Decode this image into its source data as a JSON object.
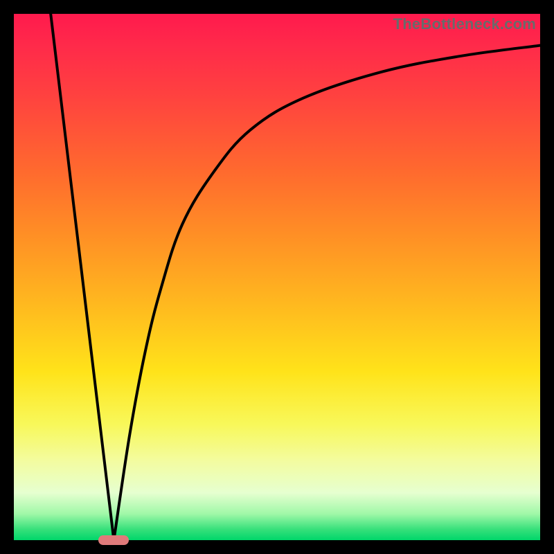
{
  "watermark": "TheBottleneck.com",
  "chart_data": {
    "type": "line",
    "title": "",
    "xlabel": "",
    "ylabel": "",
    "xlim": [
      0,
      100
    ],
    "ylim": [
      0,
      100
    ],
    "grid": false,
    "legend": false,
    "annotations": [],
    "series": [
      {
        "name": "left-falling-line",
        "x": [
          7,
          19
        ],
        "y": [
          100,
          0
        ]
      },
      {
        "name": "right-rising-curve",
        "x": [
          19,
          22,
          25,
          28,
          32,
          38,
          45,
          55,
          70,
          85,
          100
        ],
        "y": [
          0,
          20,
          36,
          48,
          60,
          70,
          78,
          84,
          89,
          92,
          94
        ]
      }
    ],
    "marker": {
      "x": 19,
      "y": 0,
      "color": "#e07a7a"
    },
    "gradient_stops": [
      {
        "pos": 0.0,
        "color": "#ff1a4d"
      },
      {
        "pos": 0.3,
        "color": "#ff6a2e"
      },
      {
        "pos": 0.55,
        "color": "#ffb81f"
      },
      {
        "pos": 0.78,
        "color": "#f8f85a"
      },
      {
        "pos": 0.95,
        "color": "#a0f8a8"
      },
      {
        "pos": 1.0,
        "color": "#00d66a"
      }
    ]
  }
}
